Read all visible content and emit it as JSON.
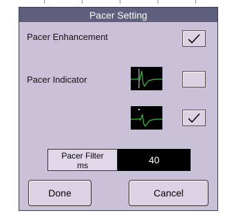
{
  "dialog": {
    "title": "Pacer Setting",
    "pacer_enhancement": {
      "label": "Pacer Enhancement",
      "checked": true
    },
    "pacer_indicator": {
      "label": "Pacer Indicator",
      "options": [
        {
          "waveform": "ecg-with-pacer-marker-icon",
          "checked": false
        },
        {
          "waveform": "ecg-without-pacer-marker-icon",
          "checked": true
        }
      ]
    },
    "pacer_filter": {
      "label_line1": "Pacer Filter",
      "label_line2": "ms",
      "value": "40"
    },
    "buttons": {
      "done": "Done",
      "cancel": "Cancel"
    }
  },
  "colors": {
    "dialog_bg": "#c9c1d8",
    "title_bg": "#5d5f7c",
    "waveform": "#39c43a",
    "pacer_marker": "#e6e6e6"
  }
}
